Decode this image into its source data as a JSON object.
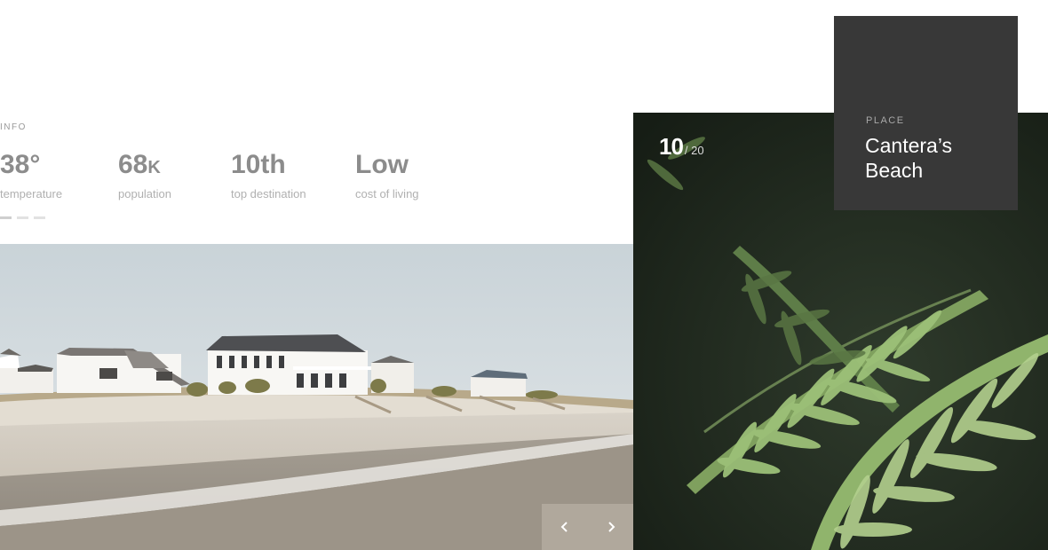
{
  "info": {
    "label": "INFO",
    "stats": [
      {
        "value": "38°",
        "unit": "",
        "label": "temperature"
      },
      {
        "value": "68",
        "unit": "K",
        "label": "population"
      },
      {
        "value": "10th",
        "unit": "",
        "label": "top destination"
      },
      {
        "value": "Low",
        "unit": "",
        "label": "cost of living"
      }
    ],
    "pager": {
      "count": 3,
      "active_index": 0
    }
  },
  "slider": {
    "current": "10",
    "total": "/ 20",
    "prev_icon": "chevron-left-icon",
    "next_icon": "chevron-right-icon"
  },
  "place": {
    "label": "PLACE",
    "name": "Cantera’s Beach"
  },
  "colors": {
    "card_bg": "#383838",
    "stat_value": "#8c8c8c",
    "stat_label": "#b0b0b0",
    "nav_bg": "#b4aca0"
  }
}
